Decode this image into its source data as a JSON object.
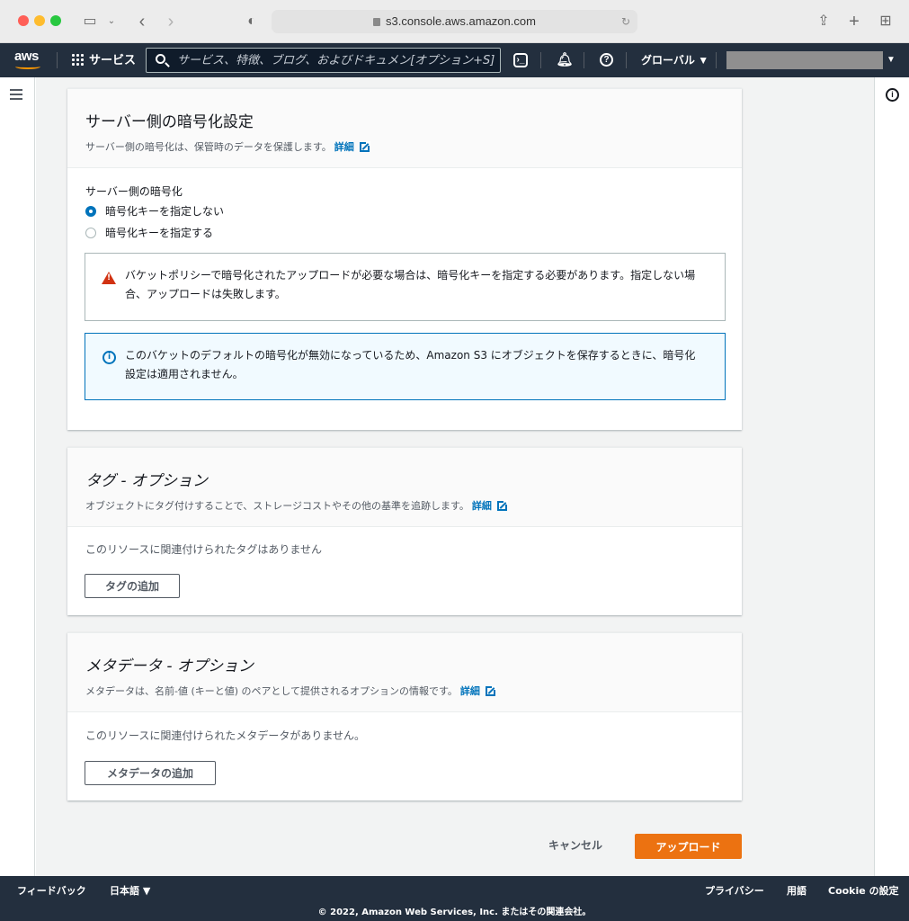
{
  "browser": {
    "url": "s3.console.aws.amazon.com"
  },
  "nav": {
    "logo": "aws",
    "services": "サービス",
    "search_placeholder": "サービス、特徴、ブログ、およびドキュメン[オプション+S]",
    "region": "グローバル ▼",
    "account_caret": "▼"
  },
  "encryption": {
    "title": "サーバー側の暗号化設定",
    "description": "サーバー側の暗号化は、保管時のデータを保護します。",
    "link": "詳細",
    "field_label": "サーバー側の暗号化",
    "options": [
      {
        "label": "暗号化キーを指定しない",
        "selected": true
      },
      {
        "label": "暗号化キーを指定する",
        "selected": false
      }
    ],
    "warning_text": "バケットポリシーで暗号化されたアップロードが必要な場合は、暗号化キーを指定する必要があります。指定しない場合、アップロードは失敗します。",
    "info_text": "このバケットのデフォルトの暗号化が無効になっているため、Amazon S3 にオブジェクトを保存するときに、暗号化設定は適用されません。"
  },
  "tags": {
    "title": "タグ - オプション",
    "description": "オブジェクトにタグ付けすることで、ストレージコストやその他の基準を追跡します。",
    "link": "詳細",
    "empty": "このリソースに関連付けられたタグはありません",
    "add_button": "タグの追加"
  },
  "metadata": {
    "title": "メタデータ - オプション",
    "description": "メタデータは、名前-値 (キーと値) のペアとして提供されるオプションの情報です。",
    "link": "詳細",
    "empty": "このリソースに関連付けられたメタデータがありません。",
    "add_button": "メタデータの追加"
  },
  "actions": {
    "cancel": "キャンセル",
    "upload": "アップロード"
  },
  "footer": {
    "feedback": "フィードバック",
    "language": "日本語 ▼",
    "privacy": "プライバシー",
    "terms": "用語",
    "cookie": "Cookie の設定",
    "copyright": "© 2022, Amazon Web Services, Inc. またはその関連会社。"
  },
  "colors": {
    "nav_bg": "#232f3e",
    "link": "#0073bb",
    "primary_button": "#ec7211",
    "warning": "#d13212"
  }
}
